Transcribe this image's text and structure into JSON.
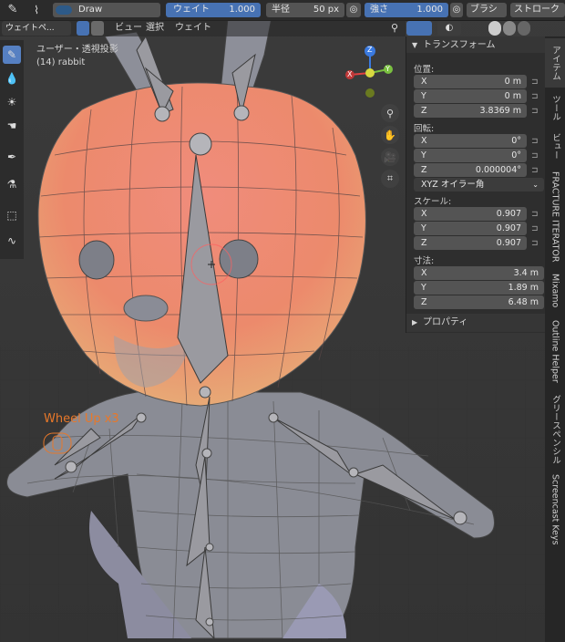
{
  "header": {
    "mode": "ウェイトペ...",
    "brush_name": "Draw",
    "weight_label": "ウェイト",
    "weight_value": "1.000",
    "radius_label": "半径",
    "radius_value": "50 px",
    "strength_label": "強さ",
    "strength_value": "1.000",
    "brush_menu": "ブラシ",
    "stroke_menu": "ストローク"
  },
  "viewport_menu": {
    "view": "ビュー",
    "select": "選択",
    "weight": "ウェイト"
  },
  "viewport_info": {
    "projection": "ユーザー・透視投影",
    "object": "(14) rabbit"
  },
  "overlay": {
    "wheel_text": "Wheel Up x3"
  },
  "gizmo": {
    "x": "X",
    "y": "Y",
    "z": "Z"
  },
  "npanel": {
    "transform_title": "トランスフォーム",
    "location_label": "位置:",
    "location": [
      {
        "axis": "X",
        "value": "0 m"
      },
      {
        "axis": "Y",
        "value": "0 m"
      },
      {
        "axis": "Z",
        "value": "3.8369 m"
      }
    ],
    "rotation_label": "回転:",
    "rotation": [
      {
        "axis": "X",
        "value": "0°"
      },
      {
        "axis": "Y",
        "value": "0°"
      },
      {
        "axis": "Z",
        "value": "0.000004°"
      }
    ],
    "rotation_mode": "XYZ オイラー角",
    "scale_label": "スケール:",
    "scale": [
      {
        "axis": "X",
        "value": "0.907"
      },
      {
        "axis": "Y",
        "value": "0.907"
      },
      {
        "axis": "Z",
        "value": "0.907"
      }
    ],
    "dimensions_label": "寸法:",
    "dimensions": [
      {
        "axis": "X",
        "value": "3.4 m"
      },
      {
        "axis": "Y",
        "value": "1.89 m"
      },
      {
        "axis": "Z",
        "value": "6.48 m"
      }
    ],
    "properties_title": "プロパティ"
  },
  "tabs": [
    "アイテム",
    "ツール",
    "ビュー",
    "FRACTURE ITERATOR",
    "Mixamo",
    "Outline Helper",
    "グリースペンシル",
    "Screencast Keys"
  ],
  "colors": {
    "accent": "#4772b3",
    "overlay_text": "#e8782a",
    "active_tool": "#5680c2"
  }
}
